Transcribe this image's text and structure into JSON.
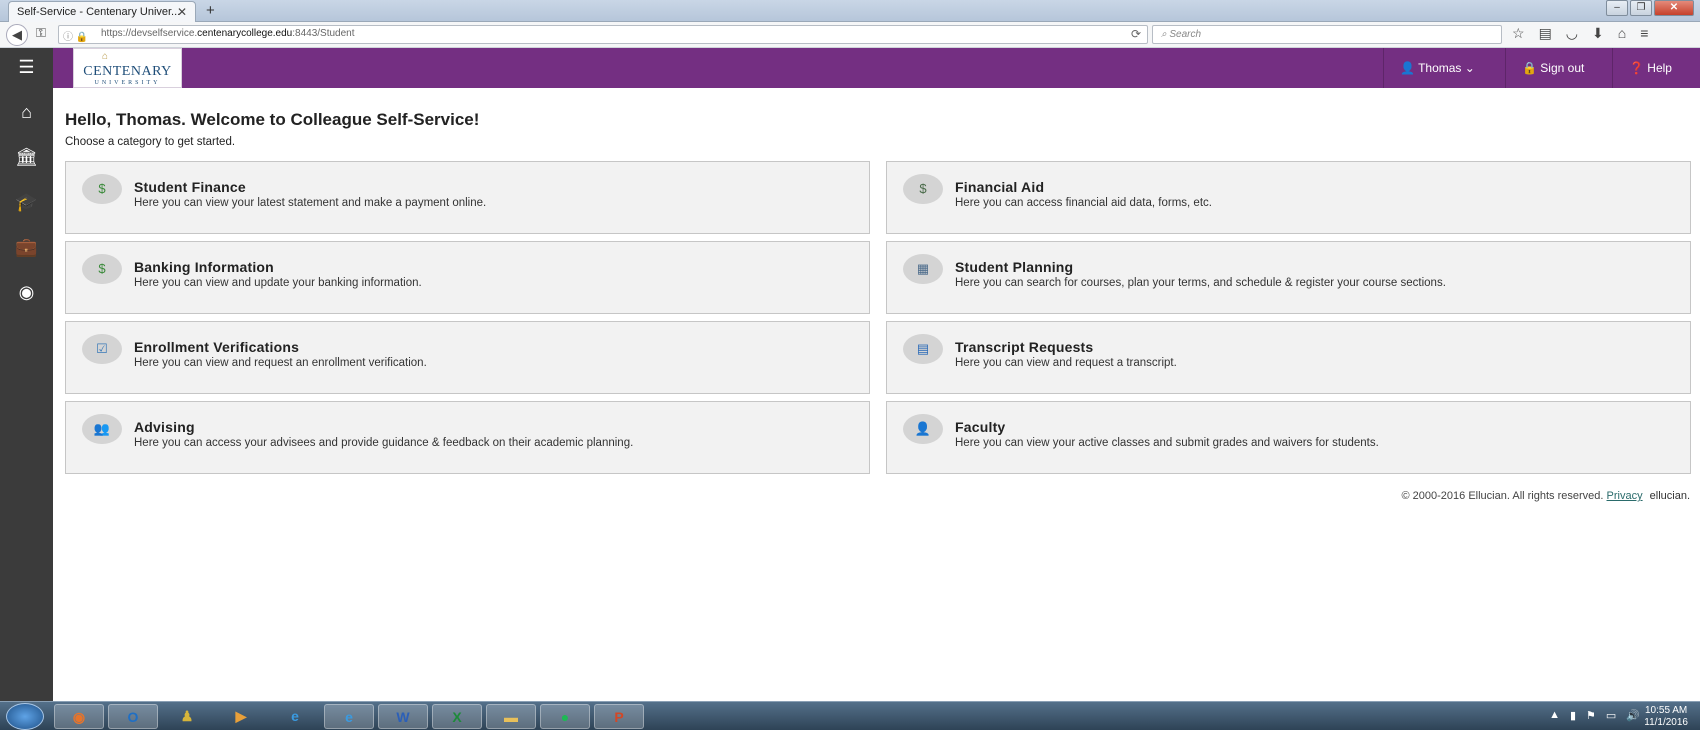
{
  "browser": {
    "tab_title": "Self-Service - Centenary Univer...",
    "tab_close": "✕",
    "new_tab": "+",
    "url_prefix": "https://devselfservice.",
    "url_domain": "centenarycollege.edu",
    "url_suffix": ":8443/Student",
    "search_placeholder": "Search"
  },
  "logo": {
    "main": "CENTENARY",
    "sub": "UNIVERSITY"
  },
  "header": {
    "user_label": "Thomas",
    "signout_label": "Sign out",
    "help_label": "Help"
  },
  "page": {
    "title": "Hello, Thomas. Welcome to Colleague Self-Service!",
    "subtitle": "Choose a category to get started."
  },
  "cards": [
    {
      "title": "Student Finance",
      "desc": "Here you can view your latest statement and make a payment online.",
      "icon": "dollar-icon",
      "glyph": "$",
      "color": "#3a8a3a"
    },
    {
      "title": "Financial Aid",
      "desc": "Here you can access financial aid data, forms, etc.",
      "icon": "document-dollar-icon",
      "glyph": "$",
      "color": "#4a6b4a"
    },
    {
      "title": "Banking Information",
      "desc": "Here you can view and update your banking information.",
      "icon": "money-icon",
      "glyph": "$",
      "color": "#3a8a3a"
    },
    {
      "title": "Student Planning",
      "desc": "Here you can search for courses, plan your terms, and schedule & register your course sections.",
      "icon": "calendar-icon",
      "glyph": "▦",
      "color": "#4a6a8a"
    },
    {
      "title": "Enrollment Verifications",
      "desc": "Here you can view and request an enrollment verification.",
      "icon": "checkbox-icon",
      "glyph": "☑",
      "color": "#3a7ab8"
    },
    {
      "title": "Transcript Requests",
      "desc": "Here you can view and request a transcript.",
      "icon": "transcript-icon",
      "glyph": "▤",
      "color": "#2a6ab8"
    },
    {
      "title": "Advising",
      "desc": "Here you can access your advisees and provide guidance & feedback on their academic planning.",
      "icon": "people-icon",
      "glyph": "👥",
      "color": "#3a6a9a"
    },
    {
      "title": "Faculty",
      "desc": "Here you can view your active classes and submit grades and waivers for students.",
      "icon": "faculty-icon",
      "glyph": "👤",
      "color": "#3a8a3a"
    }
  ],
  "footer": {
    "copyright": "© 2000-2016 Ellucian. All rights reserved.",
    "privacy": "Privacy",
    "brand": "ellucian."
  },
  "taskbar": {
    "time": "10:55 AM",
    "date": "11/1/2016"
  }
}
